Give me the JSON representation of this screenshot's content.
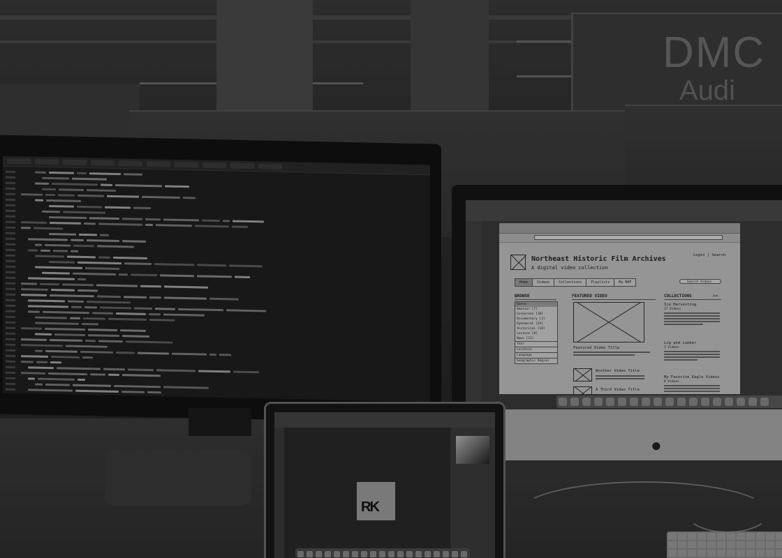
{
  "scene": {
    "sign": {
      "line1": "DMC",
      "line2": "Audi"
    },
    "left_monitor": {
      "code_line_count": 44
    },
    "right_monitor": {
      "wireframe": {
        "title": "Northeast Historic Film Archives",
        "subtitle": "A digital video collection",
        "login": "Login | Search",
        "nav": [
          "Home",
          "Videos",
          "Collections",
          "Playlists",
          "My NHF"
        ],
        "search_placeholder": "Search Videos",
        "browse_heading": "BROWSE",
        "browse_items": [
          "Genre",
          "Amateur [7]",
          "Corporate [10]",
          "Documentary [2]",
          "Ephemeral [24]",
          "Historical [10]",
          "Lecture [8]",
          "News [21]"
        ],
        "browse_more": [
          "Year",
          "Location",
          "Language",
          "Geographic Region"
        ],
        "featured_heading": "FEATURED VIDEO",
        "featured_title": "Featured Video Title",
        "video2_title": "Another Video Title",
        "video3_title": "A Third Video Title",
        "collections_heading": "COLLECTIONS",
        "collections_more": ">>",
        "collections": [
          {
            "name": "Ice Harvesting",
            "count": "17 Videos"
          },
          {
            "name": "Log and Lumber",
            "count": "3 Videos"
          },
          {
            "name": "My Favorite Eagle Videos",
            "count": "8 Videos"
          }
        ]
      }
    },
    "laptop": {
      "logo": "RK"
    }
  }
}
